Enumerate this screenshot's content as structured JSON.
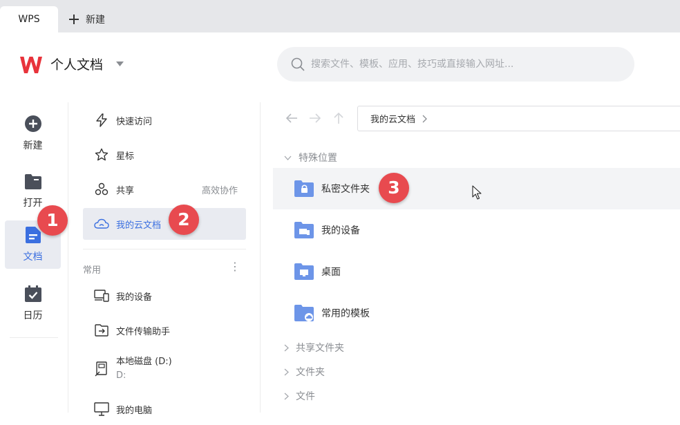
{
  "tabs": {
    "app_tab": "WPS",
    "new_tab": "新建"
  },
  "header": {
    "workspace_title": "个人文档",
    "search_placeholder": "搜索文件、模板、应用、技巧或直接输入网址..."
  },
  "rail": {
    "items": [
      {
        "label": "新建",
        "icon": "plus-circle-icon"
      },
      {
        "label": "打开",
        "icon": "folder-open-icon"
      },
      {
        "label": "文档",
        "icon": "document-icon",
        "active": true
      },
      {
        "label": "日历",
        "icon": "calendar-icon"
      }
    ]
  },
  "nav": {
    "quick_access": "快速访问",
    "starred": "星标",
    "shared": "共享",
    "shared_extra": "高效协作",
    "my_cloud": "我的云文档",
    "section_common": "常用",
    "more": "⋮",
    "my_devices": "我的设备",
    "file_transfer": "文件传输助手",
    "local_disk": "本地磁盘 (D:)",
    "local_disk_sub": "D:",
    "my_computer": "我的电脑"
  },
  "main": {
    "breadcrumb": "我的云文档",
    "group_special": "特殊位置",
    "folders": [
      {
        "name": "私密文件夹",
        "icon": "lock-folder-icon"
      },
      {
        "name": "我的设备",
        "icon": "device-folder-icon"
      },
      {
        "name": "桌面",
        "icon": "desktop-folder-icon"
      },
      {
        "name": "常用的模板",
        "icon": "cloud-folder-icon"
      }
    ],
    "group_shared": "共享文件夹",
    "group_folders": "文件夹",
    "group_files": "文件"
  },
  "badges": {
    "one": "1",
    "two": "2",
    "three": "3"
  },
  "colors": {
    "accent": "#3b6fe0",
    "badge": "#e84a4f",
    "folder": "#6d95e8",
    "logo_red": "#e8333b"
  }
}
